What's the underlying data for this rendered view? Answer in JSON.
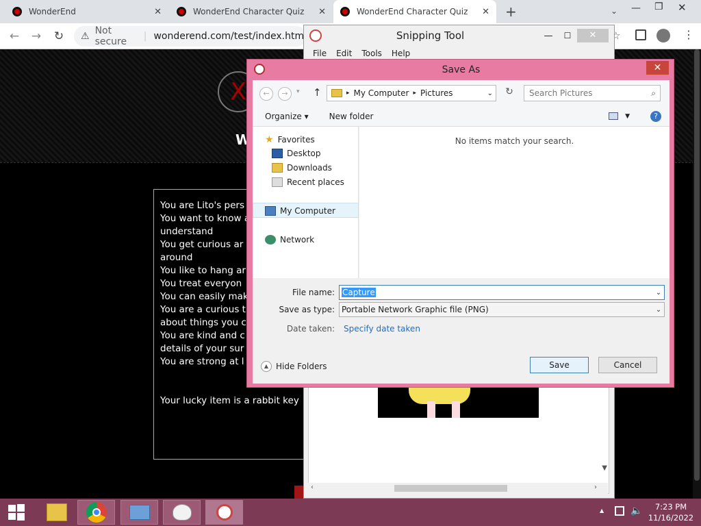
{
  "browser": {
    "tabs": [
      {
        "title": "WonderEnd"
      },
      {
        "title": "WonderEnd Character Quiz"
      },
      {
        "title": "WonderEnd Character Quiz"
      }
    ],
    "security_label": "Not secure",
    "url": "wonderend.com/test/index.html"
  },
  "quiz": {
    "lines": [
      "You are Lito's pers",
      "You want to know a",
      "understand",
      "You get curious  ar",
      "around",
      "You like to hang ar",
      "You treat everyon",
      "You can easily mak",
      "You are a curious t",
      "about things you c",
      "You are kind and c",
      "details of your sur",
      "You are strong at l"
    ],
    "lucky_item": "Your lucky item is a rabbit key"
  },
  "snipping_tool": {
    "title": "Snipping Tool",
    "menu": [
      "File",
      "Edit",
      "Tools",
      "Help"
    ]
  },
  "save_as": {
    "title": "Save As",
    "breadcrumb": [
      "My Computer",
      "Pictures"
    ],
    "search_placeholder": "Search Pictures",
    "organize": "Organize",
    "new_folder": "New folder",
    "nav": {
      "favorites": "Favorites",
      "desktop": "Desktop",
      "downloads": "Downloads",
      "recent": "Recent places",
      "my_computer": "My Computer",
      "network": "Network"
    },
    "empty_message": "No items match your search.",
    "file_name_label": "File name:",
    "file_name_value": "Capture",
    "save_type_label": "Save as type:",
    "save_type_value": "Portable Network Graphic file (PNG)",
    "date_taken_label": "Date taken:",
    "date_taken_link": "Specify date taken",
    "hide_folders": "Hide Folders",
    "save_button": "Save",
    "cancel_button": "Cancel"
  },
  "taskbar": {
    "time": "7:23 PM",
    "date": "11/16/2022"
  },
  "colors": {
    "dialog_frame": "#e87ba1",
    "taskbar": "#7c3a55",
    "link": "#1a6fc9"
  }
}
